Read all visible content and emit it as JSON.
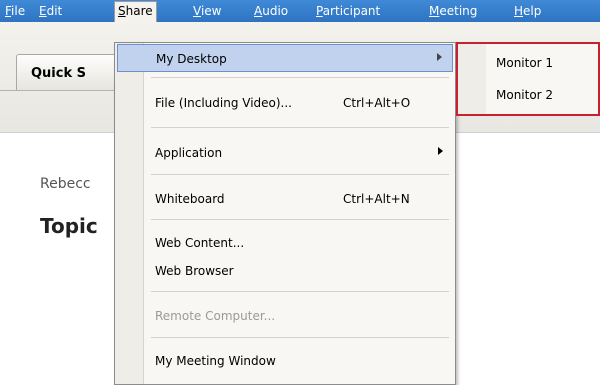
{
  "menubar": {
    "items": [
      {
        "label": "File",
        "mnemonic": "F",
        "rest": "ile"
      },
      {
        "label": "Edit",
        "mnemonic": "E",
        "rest": "dit"
      },
      {
        "label": "Share",
        "mnemonic": "S",
        "rest": "hare"
      },
      {
        "label": "View",
        "mnemonic": "V",
        "rest": "iew"
      },
      {
        "label": "Audio",
        "mnemonic": "A",
        "rest": "udio"
      },
      {
        "label": "Participant",
        "mnemonic": "P",
        "rest": "articipant"
      },
      {
        "label": "Meeting",
        "mnemonic": "M",
        "rest": "eeting"
      },
      {
        "label": "Help",
        "mnemonic": "H",
        "rest": "elp"
      }
    ]
  },
  "background": {
    "tab_label": "Quick S",
    "name_text": "Rebecc",
    "topic_text": "Topic"
  },
  "share_menu": {
    "items": [
      {
        "label": "My Desktop",
        "shortcut": ""
      },
      {
        "label": "File (Including Video)...",
        "shortcut": "Ctrl+Alt+O"
      },
      {
        "label": "Application",
        "shortcut": ""
      },
      {
        "label": "Whiteboard",
        "shortcut": "Ctrl+Alt+N"
      },
      {
        "label": "Web Content...",
        "shortcut": ""
      },
      {
        "label": "Web Browser",
        "shortcut": ""
      },
      {
        "label": "Remote Computer...",
        "shortcut": ""
      },
      {
        "label": "My Meeting Window",
        "shortcut": ""
      }
    ]
  },
  "desktop_submenu": {
    "items": [
      {
        "label": "Monitor 1"
      },
      {
        "label": "Monitor 2"
      }
    ]
  },
  "colors": {
    "menubar": "#3f8ad6",
    "highlight": "#c1d2ee",
    "callout_border": "#c8202f"
  }
}
